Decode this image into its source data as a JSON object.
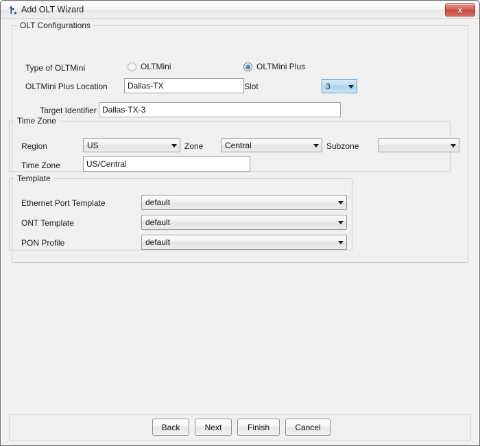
{
  "window": {
    "title": "Add OLT Wizard",
    "icon": "wizard-icon",
    "close_label": "x"
  },
  "olt_configurations": {
    "group_title": "OLT Configurations",
    "type_label": "Type of OLTMini",
    "radios": [
      {
        "label": "OLTMini",
        "checked": false
      },
      {
        "label": "OLTMini Plus",
        "checked": true
      }
    ],
    "location_label": "OLTMini Plus Location",
    "location_value": "Dallas-TX",
    "slot_label": "Slot",
    "slot_value": "3",
    "target_identifier_label": "Target Identifier",
    "target_identifier_value": "Dallas-TX-3"
  },
  "time_zone": {
    "group_title": "Time Zone",
    "region_label": "Region",
    "region_value": "US",
    "zone_label": "Zone",
    "zone_value": "Central",
    "subzone_label": "Subzone",
    "subzone_value": "",
    "timezone_label": "Time Zone",
    "timezone_value": "US/Central"
  },
  "template": {
    "group_title": "Template",
    "rows": [
      {
        "label": "Ethernet Port Template",
        "value": "default"
      },
      {
        "label": "ONT Template",
        "value": "default"
      },
      {
        "label": "PON Profile",
        "value": "default"
      }
    ]
  },
  "buttons": {
    "back": "Back",
    "next": "Next",
    "finish": "Finish",
    "cancel": "Cancel"
  },
  "colors": {
    "window_bg": "#f0f0f0",
    "accent_focus": "#a6d2ec",
    "close_red": "#c64a40",
    "group_border": "#c6cdd4"
  }
}
